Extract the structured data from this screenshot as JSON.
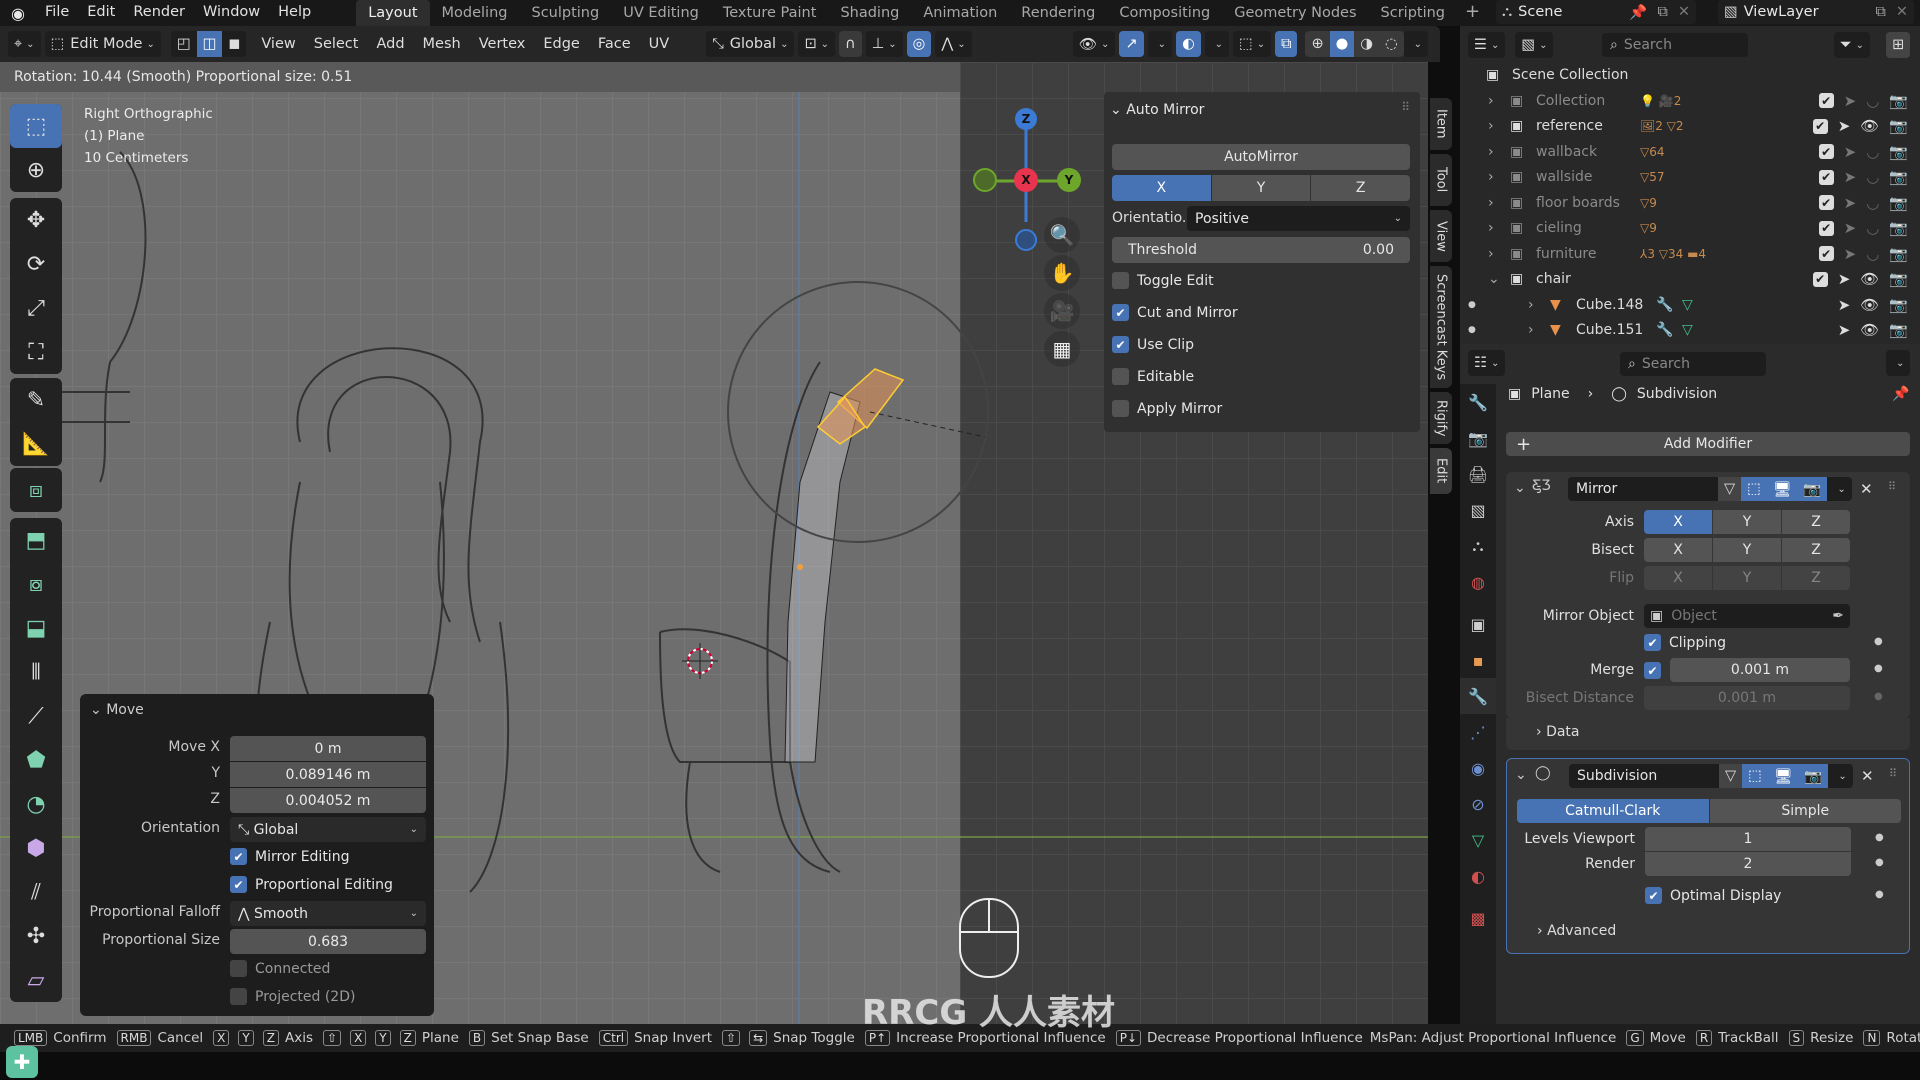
{
  "topbar": {
    "menus": [
      "File",
      "Edit",
      "Render",
      "Window",
      "Help"
    ],
    "workspaces": [
      "Layout",
      "Modeling",
      "Sculpting",
      "UV Editing",
      "Texture Paint",
      "Shading",
      "Animation",
      "Rendering",
      "Compositing",
      "Geometry Nodes",
      "Scripting"
    ],
    "active_workspace": "Layout",
    "scene": "Scene",
    "view_layer": "ViewLayer"
  },
  "header": {
    "mode": "Edit Mode",
    "menus": [
      "View",
      "Select",
      "Add",
      "Mesh",
      "Vertex",
      "Edge",
      "Face",
      "UV"
    ],
    "orientation": "Global",
    "select_mode_active": "edge"
  },
  "operator_status": "Rotation: 10.44 (Smooth) Proportional size: 0.51",
  "viewport": {
    "view_name": "Right Orthographic",
    "object": "(1) Plane",
    "scale": "10 Centimeters",
    "gizmo": {
      "z": "Z",
      "x": "X",
      "y": "Y"
    },
    "accent_x": "#e8344e",
    "accent_y": "#6ea62c",
    "accent_z": "#3b7bd6"
  },
  "automirror": {
    "title": "Auto Mirror",
    "button": "AutoMirror",
    "axes": [
      "X",
      "Y",
      "Z"
    ],
    "active_axis": "X",
    "orientation_label": "Orientatio...",
    "orientation_value": "Positive",
    "threshold_label": "Threshold",
    "threshold_value": "0.00",
    "options": [
      {
        "label": "Toggle Edit",
        "checked": false
      },
      {
        "label": "Cut and Mirror",
        "checked": true
      },
      {
        "label": "Use Clip",
        "checked": true
      },
      {
        "label": "Editable",
        "checked": false
      },
      {
        "label": "Apply Mirror",
        "checked": false
      }
    ]
  },
  "sidetabs": [
    "Item",
    "Tool",
    "View",
    "Screencast Keys",
    "Rigify",
    "Edit"
  ],
  "outliner": {
    "search_placeholder": "Search",
    "root": "Scene Collection",
    "rows": [
      {
        "name": "Collection",
        "dim": true,
        "badges": "💡 🎥2"
      },
      {
        "name": "reference",
        "dim": false,
        "badges": "🖼2 ▽2"
      },
      {
        "name": "wallback",
        "dim": true,
        "badges": "▽64"
      },
      {
        "name": "wallside",
        "dim": true,
        "badges": "▽57"
      },
      {
        "name": "floor boards",
        "dim": true,
        "badges": "▽9"
      },
      {
        "name": "cieling",
        "dim": true,
        "badges": "▽9"
      },
      {
        "name": "furniture",
        "dim": true,
        "badges": "⅄3 ▽34 ▬4"
      },
      {
        "name": "chair",
        "dim": false,
        "badges": ""
      },
      {
        "name": "Cube.148",
        "dim": false,
        "badges": ""
      },
      {
        "name": "Cube.151",
        "dim": false,
        "badges": ""
      }
    ]
  },
  "properties": {
    "search_placeholder": "Search",
    "breadcrumb_object": "Plane",
    "breadcrumb_modifier": "Subdivision",
    "add_modifier": "Add Modifier",
    "mirror": {
      "name": "Mirror",
      "axis_label": "Axis",
      "bisect_label": "Bisect",
      "flip_label": "Flip",
      "axes": [
        "X",
        "Y",
        "Z"
      ],
      "axis_active": "X",
      "mirror_object_label": "Mirror Object",
      "mirror_object_placeholder": "Object",
      "clipping_label": "Clipping",
      "clipping": true,
      "merge_label": "Merge",
      "merge": true,
      "merge_value": "0.001 m",
      "bisect_distance_label": "Bisect Distance",
      "bisect_distance_value": "0.001 m",
      "data_label": "Data"
    },
    "subdivision": {
      "name": "Subdivision",
      "types": [
        "Catmull-Clark",
        "Simple"
      ],
      "active_type": "Catmull-Clark",
      "levels_viewport_label": "Levels Viewport",
      "levels_viewport": "1",
      "render_label": "Render",
      "render": "2",
      "optimal_display_label": "Optimal Display",
      "optimal_display": true,
      "advanced_label": "Advanced"
    }
  },
  "move_panel": {
    "title": "Move",
    "move_x_label": "Move X",
    "move_x": "0 m",
    "y_label": "Y",
    "y": "0.089146 m",
    "z_label": "Z",
    "z": "0.004052 m",
    "orientation_label": "Orientation",
    "orientation": "Global",
    "mirror_editing_label": "Mirror Editing",
    "mirror_editing": true,
    "proportional_editing_label": "Proportional Editing",
    "proportional_editing": true,
    "falloff_label": "Proportional Falloff",
    "falloff": "Smooth",
    "size_label": "Proportional Size",
    "size": "0.683",
    "connected_label": "Connected",
    "connected": false,
    "projected_label": "Projected (2D)",
    "projected": false
  },
  "statusbar": [
    {
      "keys": [
        "LMB"
      ],
      "label": "Confirm"
    },
    {
      "keys": [
        "RMB"
      ],
      "label": "Cancel"
    },
    {
      "keys": [
        "X",
        "Y",
        "Z"
      ],
      "label": "Axis"
    },
    {
      "keys": [
        "⇧",
        "X",
        "Y",
        "Z"
      ],
      "label": "Plane"
    },
    {
      "keys": [
        "B"
      ],
      "label": "Set Snap Base"
    },
    {
      "keys": [
        "Ctrl"
      ],
      "label": "Snap Invert"
    },
    {
      "keys": [
        "⇧",
        "⇆"
      ],
      "label": "Snap Toggle"
    },
    {
      "keys": [
        "P↑"
      ],
      "label": "Increase Proportional Influence"
    },
    {
      "keys": [
        "P↓"
      ],
      "label": "Decrease Proportional Influence"
    },
    {
      "keys": [],
      "label": "MsPan: Adjust Proportional Influence"
    },
    {
      "keys": [
        "G"
      ],
      "label": "Move"
    },
    {
      "keys": [
        "R"
      ],
      "label": "TrackBall"
    },
    {
      "keys": [
        "S"
      ],
      "label": "Resize"
    },
    {
      "keys": [
        "N"
      ],
      "label": "Rotate"
    }
  ],
  "watermark": "RRCG 人人素材"
}
